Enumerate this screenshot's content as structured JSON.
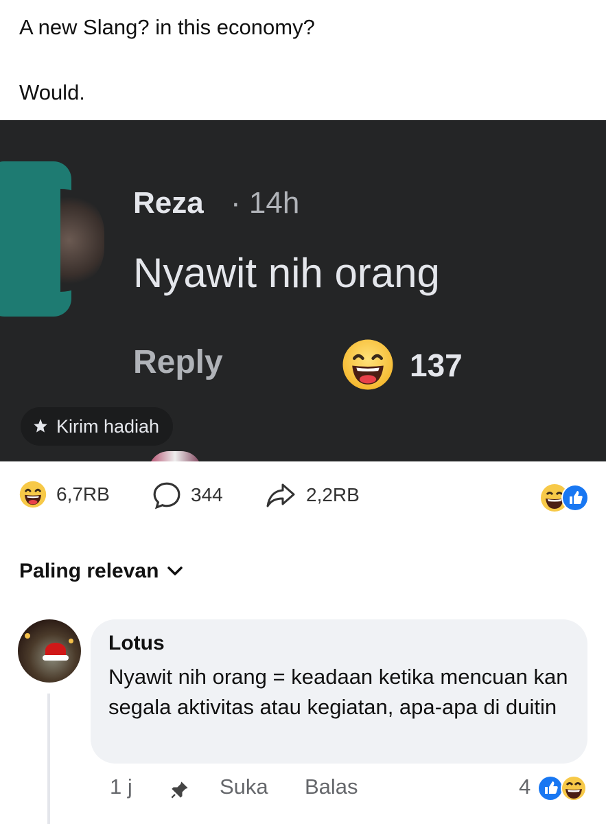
{
  "post": {
    "line1": "A new Slang? in this economy?",
    "line2": "Would."
  },
  "embedded_screenshot": {
    "author": "Reza",
    "time": "· 14h",
    "comment": "Nyawit nih orang",
    "reply_label": "Reply",
    "reaction_count": "137",
    "gift_label": "Kirim hadiah"
  },
  "reactions_bar": {
    "reactions": "6,7RB",
    "comments": "344",
    "shares": "2,2RB"
  },
  "sort": {
    "label": "Paling relevan"
  },
  "comment": {
    "author": "Lotus",
    "text": "Nyawit nih orang = keadaan ketika mencuan kan segala aktivitas atau kegiatan, apa-apa di duitin",
    "time": "1 j",
    "like_label": "Suka",
    "reply_label": "Balas",
    "reaction_count": "4"
  },
  "colors": {
    "embed_bg": "#242526",
    "teal": "#1e7b72",
    "fb_blue": "#1877f2",
    "haha_yellow": "#f7c948"
  },
  "icons": [
    "haha-emoji-icon",
    "comment-bubble-icon",
    "share-arrow-icon",
    "like-icon",
    "pin-icon",
    "gift-icon",
    "chevron-down-icon"
  ]
}
